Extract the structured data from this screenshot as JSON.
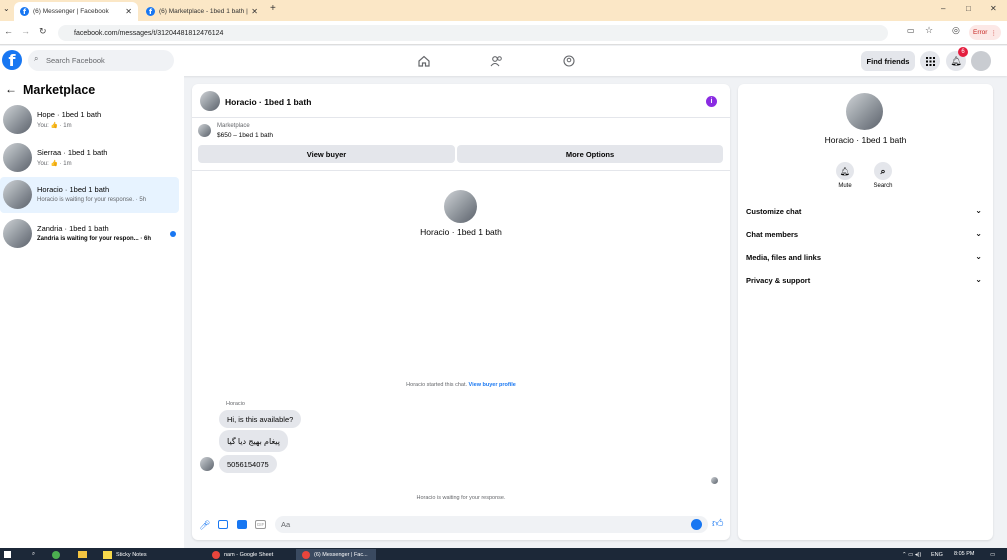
{
  "browser": {
    "tabs": [
      {
        "title": "(6) Messenger | Facebook",
        "active": true
      },
      {
        "title": "(6) Marketplace - 1bed 1 bath |",
        "active": false
      }
    ],
    "new_tab": "+",
    "url": "facebook.com/messages/t/31204481812476124",
    "error_label": "Error",
    "window_controls": [
      "–",
      "□",
      "✕"
    ]
  },
  "header": {
    "search_placeholder": "Search Facebook",
    "find_friends": "Find friends",
    "notification_count": "6"
  },
  "sidebar": {
    "title": "Marketplace",
    "conversations": [
      {
        "name": "Hope · 1bed 1 bath",
        "sub": "You: 👍 · 1m",
        "unread": false,
        "selected": false
      },
      {
        "name": "Sierraa · 1bed 1 bath",
        "sub": "You: 👍 · 1m",
        "unread": false,
        "selected": false
      },
      {
        "name": "Horacio · 1bed 1 bath",
        "sub": "Horacio is waiting for your response. · 5h",
        "unread": false,
        "selected": true
      },
      {
        "name": "Zandria · 1bed 1 bath",
        "sub": "Zandria is waiting for your respon... · 6h",
        "unread": true,
        "selected": false
      }
    ]
  },
  "chat": {
    "title": "Horacio · 1bed 1 bath",
    "listing_label": "Marketplace",
    "listing_detail": "$650 – 1bed 1 bath",
    "view_buyer": "View buyer",
    "more_options": "More Options",
    "profile_name": "Horacio · 1bed 1 bath",
    "started_text": "Horacio started this chat.",
    "view_buyer_profile": "View buyer profile",
    "sender_label": "Horacio",
    "messages": [
      "Hi, is this available?",
      "پیغام بھیج دیا گیا",
      "5056154075"
    ],
    "waiting_text": "Horacio is waiting for your response.",
    "input_placeholder": "Aa"
  },
  "info_panel": {
    "name": "Horacio · 1bed 1 bath",
    "actions": [
      "Mute",
      "Search"
    ],
    "sections": [
      "Customize chat",
      "Chat members",
      "Media, files and links",
      "Privacy & support"
    ]
  },
  "taskbar": {
    "items": [
      "Sticky Notes",
      "nam - Google Sheet",
      "(6) Messenger | Fac..."
    ],
    "lang": "ENG",
    "time": "8:05 PM"
  },
  "colors": {
    "accent": "#1877f2",
    "purple_info": "#8a2be2",
    "notification": "#e41e3f"
  }
}
